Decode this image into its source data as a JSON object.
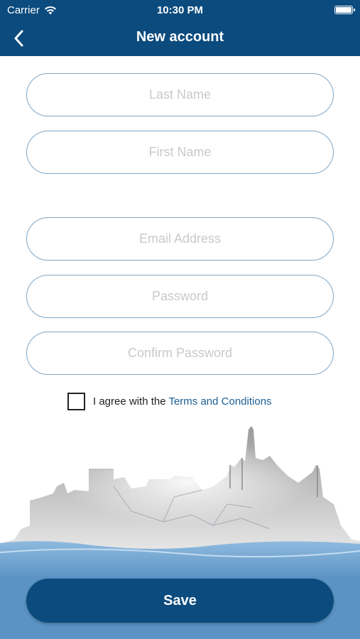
{
  "status_bar": {
    "carrier": "Carrier",
    "time": "10:30 PM",
    "wifi_icon": "wifi-icon",
    "battery_icon": "battery-icon"
  },
  "nav": {
    "title": "New account",
    "back_icon": "chevron-left-icon"
  },
  "form": {
    "last_name": {
      "placeholder": "Last Name",
      "value": ""
    },
    "first_name": {
      "placeholder": "First Name",
      "value": ""
    },
    "email": {
      "placeholder": "Email Address",
      "value": ""
    },
    "password": {
      "placeholder": "Password",
      "value": ""
    },
    "confirm_password": {
      "placeholder": "Confirm Password",
      "value": ""
    }
  },
  "agreement": {
    "text": "I agree with the ",
    "link": "Terms and Conditions",
    "checked": false
  },
  "save_label": "Save",
  "colors": {
    "primary": "#0b4b7e",
    "field_border": "#7ea6c6",
    "link": "#1a5e93",
    "water": "#5a93c4"
  }
}
